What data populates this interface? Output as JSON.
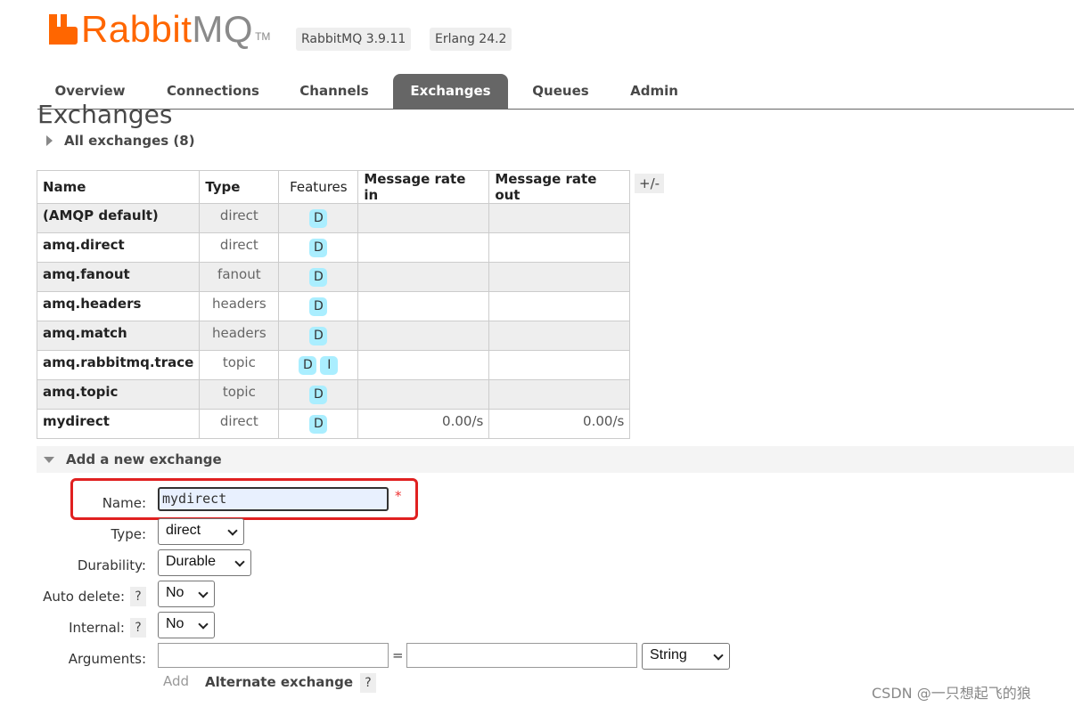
{
  "header": {
    "logo_rabbit": "Rabbit",
    "logo_mq": "MQ",
    "logo_tm": "TM",
    "version_rabbitmq": "RabbitMQ 3.9.11",
    "version_erlang": "Erlang 24.2",
    "brand_color": "#ff6600"
  },
  "tabs": [
    {
      "label": "Overview",
      "active": false
    },
    {
      "label": "Connections",
      "active": false
    },
    {
      "label": "Channels",
      "active": false
    },
    {
      "label": "Exchanges",
      "active": true
    },
    {
      "label": "Queues",
      "active": false
    },
    {
      "label": "Admin",
      "active": false
    }
  ],
  "page": {
    "title": "Exchanges",
    "all_exchanges_label": "All exchanges (8)"
  },
  "table": {
    "headers": {
      "name": "Name",
      "type": "Type",
      "features": "Features",
      "rate_in": "Message rate in",
      "rate_out": "Message rate out"
    },
    "column_toggle": "+/-",
    "rows": [
      {
        "name": "(AMQP default)",
        "type": "direct",
        "features": [
          "D"
        ],
        "rate_in": "",
        "rate_out": ""
      },
      {
        "name": "amq.direct",
        "type": "direct",
        "features": [
          "D"
        ],
        "rate_in": "",
        "rate_out": ""
      },
      {
        "name": "amq.fanout",
        "type": "fanout",
        "features": [
          "D"
        ],
        "rate_in": "",
        "rate_out": ""
      },
      {
        "name": "amq.headers",
        "type": "headers",
        "features": [
          "D"
        ],
        "rate_in": "",
        "rate_out": ""
      },
      {
        "name": "amq.match",
        "type": "headers",
        "features": [
          "D"
        ],
        "rate_in": "",
        "rate_out": ""
      },
      {
        "name": "amq.rabbitmq.trace",
        "type": "topic",
        "features": [
          "D",
          "I"
        ],
        "rate_in": "",
        "rate_out": ""
      },
      {
        "name": "amq.topic",
        "type": "topic",
        "features": [
          "D"
        ],
        "rate_in": "",
        "rate_out": ""
      },
      {
        "name": "mydirect",
        "type": "direct",
        "features": [
          "D"
        ],
        "rate_in": "0.00/s",
        "rate_out": "0.00/s"
      }
    ]
  },
  "add_exchange": {
    "section_title": "Add a new exchange",
    "name_label": "Name:",
    "name_value": "mydirect",
    "required_mark": "*",
    "type_label": "Type:",
    "type_value": "direct",
    "durability_label": "Durability:",
    "durability_value": "Durable",
    "auto_delete_label": "Auto delete:",
    "auto_delete_value": "No",
    "internal_label": "Internal:",
    "internal_value": "No",
    "arguments_label": "Arguments:",
    "arguments_equals": "=",
    "arguments_type_value": "String",
    "help": "?",
    "add_label": "Add",
    "alternate_exchange_label": "Alternate exchange"
  },
  "watermark": "CSDN @一只想起飞的狼"
}
